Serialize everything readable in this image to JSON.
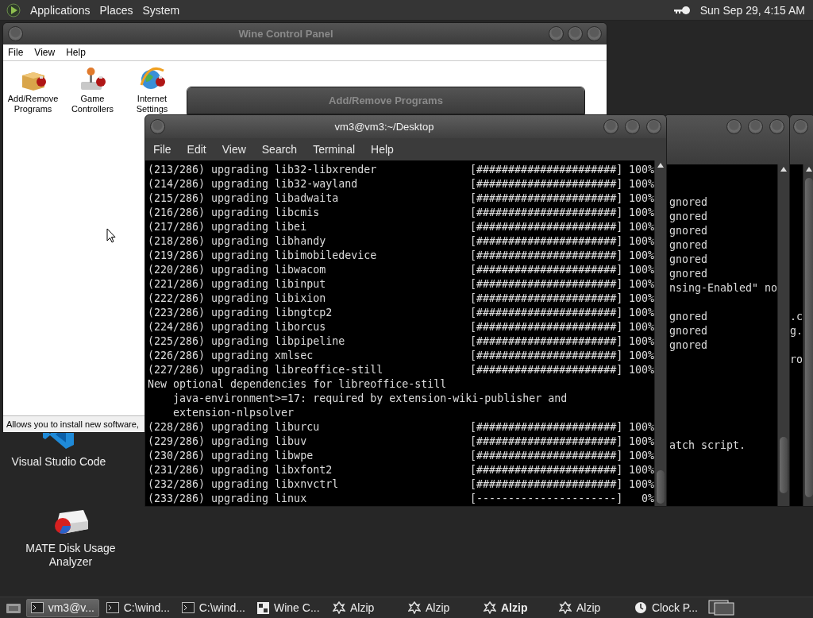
{
  "top_panel": {
    "menus": [
      "Applications",
      "Places",
      "System"
    ],
    "clock": "Sun Sep 29, 4:15 AM"
  },
  "desktop_icons": [
    {
      "label": "Visual Studio Code",
      "kind": "vscode"
    },
    {
      "label": "MATE Disk Usage Analyzer",
      "kind": "disk"
    }
  ],
  "wine_window": {
    "title": "Wine Control Panel",
    "active": false,
    "menu": [
      "File",
      "View",
      "Help"
    ],
    "applets": [
      {
        "label": "Add/Remove Programs",
        "kind": "box"
      },
      {
        "label": "Game Controllers",
        "kind": "joystick"
      },
      {
        "label": "Internet Settings",
        "kind": "globe"
      }
    ],
    "status": "Allows you to install new software,"
  },
  "dialog": {
    "title": "Add/Remove Programs",
    "active": false
  },
  "terminal": {
    "title": "vm3@vm3:~/Desktop",
    "active": true,
    "menu": [
      "File",
      "Edit",
      "View",
      "Search",
      "Terminal",
      "Help"
    ],
    "lines": [
      {
        "kind": "progress",
        "text": "(213/286) upgrading lib32-libxrender",
        "bar": "[######################]",
        "percent": "100%"
      },
      {
        "kind": "progress",
        "text": "(214/286) upgrading lib32-wayland",
        "bar": "[######################]",
        "percent": "100%"
      },
      {
        "kind": "progress",
        "text": "(215/286) upgrading libadwaita",
        "bar": "[######################]",
        "percent": "100%"
      },
      {
        "kind": "progress",
        "text": "(216/286) upgrading libcmis",
        "bar": "[######################]",
        "percent": "100%"
      },
      {
        "kind": "progress",
        "text": "(217/286) upgrading libei",
        "bar": "[######################]",
        "percent": "100%"
      },
      {
        "kind": "progress",
        "text": "(218/286) upgrading libhandy",
        "bar": "[######################]",
        "percent": "100%"
      },
      {
        "kind": "progress",
        "text": "(219/286) upgrading libimobiledevice",
        "bar": "[######################]",
        "percent": "100%"
      },
      {
        "kind": "progress",
        "text": "(220/286) upgrading libwacom",
        "bar": "[######################]",
        "percent": "100%"
      },
      {
        "kind": "progress",
        "text": "(221/286) upgrading libinput",
        "bar": "[######################]",
        "percent": "100%"
      },
      {
        "kind": "progress",
        "text": "(222/286) upgrading libixion",
        "bar": "[######################]",
        "percent": "100%"
      },
      {
        "kind": "progress",
        "text": "(223/286) upgrading libngtcp2",
        "bar": "[######################]",
        "percent": "100%"
      },
      {
        "kind": "progress",
        "text": "(224/286) upgrading liborcus",
        "bar": "[######################]",
        "percent": "100%"
      },
      {
        "kind": "progress",
        "text": "(225/286) upgrading libpipeline",
        "bar": "[######################]",
        "percent": "100%"
      },
      {
        "kind": "progress",
        "text": "(226/286) upgrading xmlsec",
        "bar": "[######################]",
        "percent": "100%"
      },
      {
        "kind": "progress",
        "text": "(227/286) upgrading libreoffice-still",
        "bar": "[######################]",
        "percent": "100%"
      },
      {
        "kind": "message",
        "text": "New optional dependencies for libreoffice-still",
        "details": [
          "java-environment>=17: required by extension-wiki-publisher and",
          "extension-nlpsolver"
        ]
      },
      {
        "kind": "progress",
        "text": "(228/286) upgrading liburcu",
        "bar": "[######################]",
        "percent": "100%"
      },
      {
        "kind": "progress",
        "text": "(229/286) upgrading libuv",
        "bar": "[######################]",
        "percent": "100%"
      },
      {
        "kind": "progress",
        "text": "(230/286) upgrading libwpe",
        "bar": "[######################]",
        "percent": "100%"
      },
      {
        "kind": "progress",
        "text": "(231/286) upgrading libxfont2",
        "bar": "[######################]",
        "percent": "100%"
      },
      {
        "kind": "progress",
        "text": "(232/286) upgrading libxnvctrl",
        "bar": "[######################]",
        "percent": "100%"
      },
      {
        "kind": "progress",
        "text": "(233/286) upgrading linux",
        "bar": "[----------------------]",
        "percent": "0%"
      }
    ]
  },
  "background_terminal": {
    "lines": [
      {
        "kind": "blank"
      },
      {
        "kind": "blank"
      },
      {
        "kind": "text",
        "text": "gnored"
      },
      {
        "kind": "text",
        "text": "gnored"
      },
      {
        "kind": "text",
        "text": "gnored"
      },
      {
        "kind": "text",
        "text": "gnored"
      },
      {
        "kind": "text",
        "text": "gnored"
      },
      {
        "kind": "text",
        "text": "gnored"
      },
      {
        "kind": "text",
        "text": "nsing-Enabled\" no"
      },
      {
        "kind": "blank"
      },
      {
        "kind": "text",
        "text": "gnored"
      },
      {
        "kind": "text",
        "text": "gnored"
      },
      {
        "kind": "text",
        "text": "gnored"
      },
      {
        "kind": "blank"
      },
      {
        "kind": "blank"
      },
      {
        "kind": "blank"
      },
      {
        "kind": "blank"
      },
      {
        "kind": "blank"
      },
      {
        "kind": "blank"
      },
      {
        "kind": "text",
        "text": "atch script."
      }
    ]
  },
  "background_terminal_2": {
    "lines": [
      {
        "kind": "blank"
      },
      {
        "kind": "blank"
      },
      {
        "kind": "blank"
      },
      {
        "kind": "blank"
      },
      {
        "kind": "blank"
      },
      {
        "kind": "blank"
      },
      {
        "kind": "blank"
      },
      {
        "kind": "blank"
      },
      {
        "kind": "blank"
      },
      {
        "kind": "blank"
      },
      {
        "kind": "text",
        "text": ".c"
      },
      {
        "kind": "text",
        "text": "g."
      },
      {
        "kind": "blank"
      },
      {
        "kind": "text",
        "text": "ro"
      }
    ]
  },
  "taskbar": {
    "items": [
      {
        "label": "vm3@v...",
        "kind": "terminal",
        "selected": true,
        "urgent": false
      },
      {
        "label": "C:\\wind...",
        "kind": "terminal",
        "selected": false,
        "urgent": false
      },
      {
        "label": "C:\\wind...",
        "kind": "terminal",
        "selected": false,
        "urgent": false
      },
      {
        "label": "Wine C...",
        "kind": "wine",
        "selected": false,
        "urgent": false
      },
      {
        "label": "Alzip",
        "kind": "alzip",
        "selected": false,
        "urgent": false
      },
      {
        "label": "Alzip",
        "kind": "alzip",
        "selected": false,
        "urgent": false
      },
      {
        "label": "Alzip",
        "kind": "alzip",
        "selected": false,
        "urgent": true
      },
      {
        "label": "Alzip",
        "kind": "alzip",
        "selected": false,
        "urgent": false
      },
      {
        "label": "Clock P...",
        "kind": "clock",
        "selected": false,
        "urgent": false
      }
    ]
  }
}
